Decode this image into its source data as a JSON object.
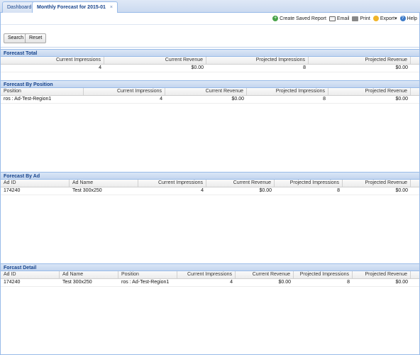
{
  "tabs": [
    {
      "label": "Dashboard"
    },
    {
      "label": "Monthly Forecast for 2015-01",
      "close": "×"
    }
  ],
  "toolbar": {
    "create_saved_report": "Create Saved Report",
    "email": "Email",
    "print": "Print",
    "export": "Export▾",
    "help": "Help",
    "add_icon_glyph": "+",
    "help_icon_glyph": "?"
  },
  "search": {
    "search_label": "Search",
    "reset_label": "Reset"
  },
  "forecast_total": {
    "title": "Forecast Total",
    "columns": [
      "Current Impressions",
      "Current Revenue",
      "Projected Impressions",
      "Projected Revenue"
    ],
    "rows": [
      [
        "4",
        "$0.00",
        "8",
        "$0.00"
      ]
    ]
  },
  "forecast_by_position": {
    "title": "Forecast By Position",
    "columns": [
      "Position",
      "Current Impressions",
      "Current Revenue",
      "Projected Impressions",
      "Projected Revenue"
    ],
    "rows": [
      [
        "ros : Ad-Test-Region1",
        "4",
        "$0.00",
        "8",
        "$0.00"
      ]
    ]
  },
  "forecast_by_ad": {
    "title": "Forecast By Ad",
    "columns": [
      "Ad ID",
      "Ad Name",
      "Current Impressions",
      "Current Revenue",
      "Projected Impressions",
      "Projected Revenue"
    ],
    "rows": [
      [
        "174240",
        "Test 300x250",
        "4",
        "$0.00",
        "8",
        "$0.00"
      ]
    ]
  },
  "forecast_detail": {
    "title": "Forcast Detail",
    "columns": [
      "Ad ID",
      "Ad Name",
      "Position",
      "Current Impressions",
      "Current Revenue",
      "Projected Impressions",
      "Projected Revenue"
    ],
    "rows": [
      [
        "174240",
        "Test 300x250",
        "ros : Ad-Test-Region1",
        "4",
        "$0.00",
        "8",
        "$0.00"
      ]
    ]
  },
  "colors": {
    "panel_header_text": "#15428b",
    "border": "#99bbe8",
    "add_icon": "#49a34a",
    "help_icon": "#3f7cc9"
  }
}
